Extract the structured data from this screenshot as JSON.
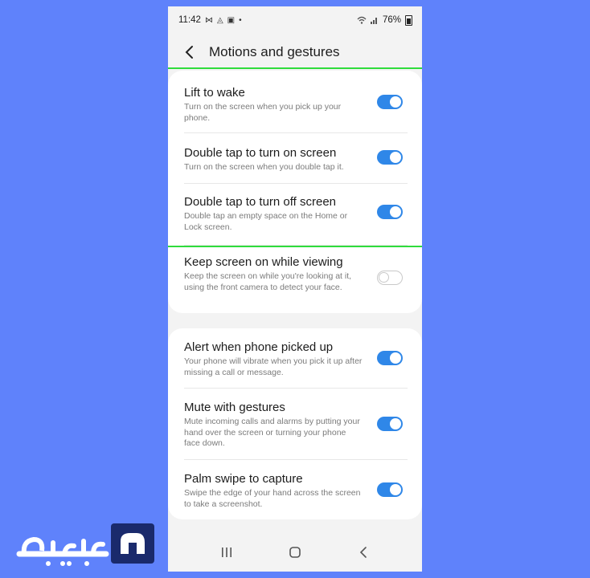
{
  "status_bar": {
    "time": "11:42",
    "left_icons": [
      "missed-call-icon",
      "android-icon",
      "image-icon",
      "dot-icon"
    ],
    "right_icons": [
      "wifi-icon",
      "signal-icon"
    ],
    "battery": "76%"
  },
  "header": {
    "title": "Motions and gestures"
  },
  "colors": {
    "accent": "#2f87e8",
    "highlight": "#2fdc3c",
    "background": "#5f82fb"
  },
  "group1": [
    {
      "title": "Lift to wake",
      "desc": "Turn on the screen when you pick up your phone.",
      "enabled": true
    },
    {
      "title": "Double tap to turn on screen",
      "desc": "Turn on the screen when you double tap it.",
      "enabled": true
    },
    {
      "title": "Double tap to turn off screen",
      "desc": "Double tap an empty space on the Home or Lock screen.",
      "enabled": true
    },
    {
      "title": "Keep screen on while viewing",
      "desc": "Keep the screen on while you're looking at it, using the front camera to detect your face.",
      "enabled": false
    }
  ],
  "group2": [
    {
      "title": "Alert when phone picked up",
      "desc": "Your phone will vibrate when you pick it up after missing a call or message.",
      "enabled": true
    },
    {
      "title": "Mute with gestures",
      "desc": "Mute incoming calls and alarms by putting your hand over the screen or turning your phone face down.",
      "enabled": true
    },
    {
      "title": "Palm swipe to capture",
      "desc": "Swipe the edge of your hand across the screen to take a screenshot.",
      "enabled": true
    }
  ],
  "nav": {
    "buttons": [
      "recents-icon",
      "home-icon",
      "back-icon"
    ]
  },
  "watermark": {
    "logo": "mobile-logo"
  }
}
